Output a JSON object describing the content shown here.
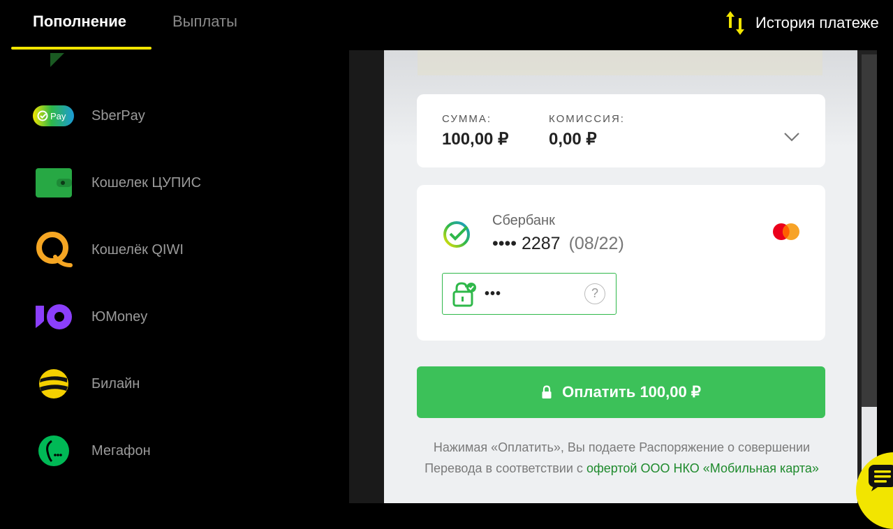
{
  "tabs": {
    "active": "Пополнение",
    "inactive": "Выплаты"
  },
  "history": {
    "label": "История платеже",
    "icon": "arrows-up-down-icon"
  },
  "methods": [
    {
      "label": "SberPay",
      "icon": "sberpay-icon",
      "badge": "Pay"
    },
    {
      "label": "Кошелек ЦУПИС",
      "icon": "wallet-icon"
    },
    {
      "label": "Кошелёк QIWI",
      "icon": "qiwi-icon"
    },
    {
      "label": "ЮMoney",
      "icon": "yumoney-icon"
    },
    {
      "label": "Билайн",
      "icon": "beeline-icon"
    },
    {
      "label": "Мегафон",
      "icon": "megafon-icon"
    }
  ],
  "payment": {
    "sum_label": "СУММА:",
    "sum_value": "100,00 ₽",
    "fee_label": "КОМИССИЯ:",
    "fee_value": "0,00 ₽",
    "bank_name": "Сбербанк",
    "card_number": "•••• 2287",
    "card_expiry": "(08/22)",
    "cvv_value": "•••",
    "help": "?",
    "pay_label": "Оплатить 100,00 ₽",
    "terms_text": "Нажимая «Оплатить», Вы подаете Распоряжение о совершении Перевода в соответствии с ",
    "terms_link": "офертой ООО НКО «Мобильная карта»"
  },
  "colors": {
    "accent": "#f2e500",
    "pay_green": "#3cc159",
    "link_green": "#1e8a2c"
  }
}
